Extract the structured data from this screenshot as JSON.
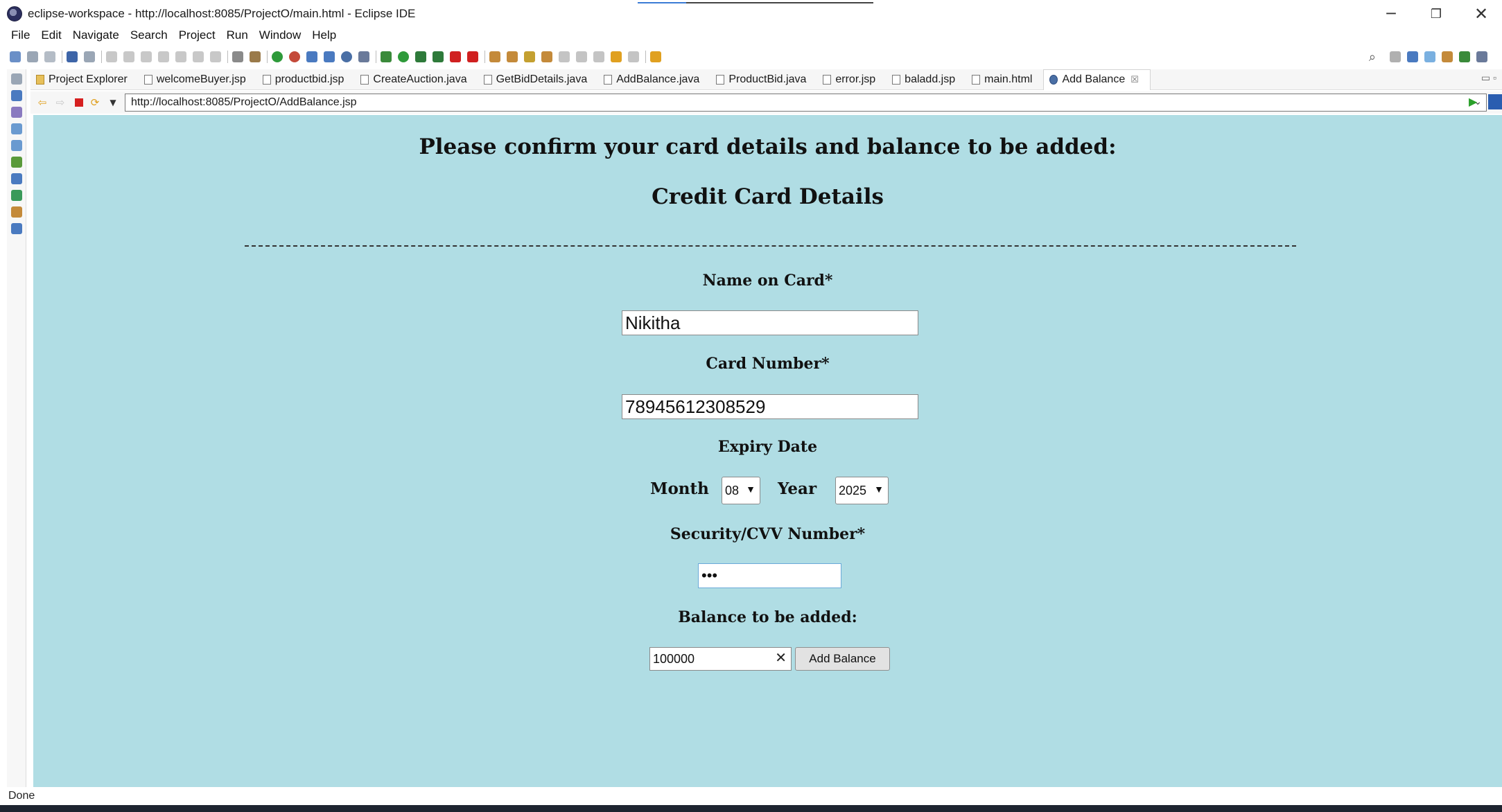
{
  "window": {
    "title": "eclipse-workspace - http://localhost:8085/ProjectO/main.html - Eclipse IDE",
    "controls": {
      "minimize": "─",
      "maximize": "❐",
      "close": "✕"
    }
  },
  "menu": [
    "File",
    "Edit",
    "Navigate",
    "Search",
    "Project",
    "Run",
    "Window",
    "Help"
  ],
  "tabs": [
    {
      "label": "Project Explorer",
      "icon": "project-explorer-icon"
    },
    {
      "label": "welcomeBuyer.jsp",
      "icon": "file-icon"
    },
    {
      "label": "productbid.jsp",
      "icon": "file-icon"
    },
    {
      "label": "CreateAuction.java",
      "icon": "java-file-icon"
    },
    {
      "label": "GetBidDetails.java",
      "icon": "java-file-icon"
    },
    {
      "label": "AddBalance.java",
      "icon": "java-file-icon"
    },
    {
      "label": "ProductBid.java",
      "icon": "java-file-icon"
    },
    {
      "label": "error.jsp",
      "icon": "file-icon"
    },
    {
      "label": "baladd.jsp",
      "icon": "file-icon"
    },
    {
      "label": "main.html",
      "icon": "file-icon"
    },
    {
      "label": "Add Balance",
      "icon": "globe-icon",
      "active": true,
      "close": "☒"
    }
  ],
  "browser": {
    "url": "http://localhost:8085/ProjectO/AddBalance.jsp"
  },
  "page": {
    "heading": "Please confirm your card details and balance to be added:",
    "subheading": "Credit Card Details",
    "name_label": "Name on Card*",
    "name_value": "Nikitha",
    "card_label": "Card Number*",
    "card_value": "78945612308529",
    "expiry_label": "Expiry Date",
    "month_label": "Month",
    "month_value": "08",
    "year_label": "Year",
    "year_value": "2025",
    "cvv_label": "Security/CVV Number*",
    "cvv_value": "•••",
    "balance_label": "Balance to be added:",
    "balance_value": "100000",
    "submit_label": "Add Balance"
  },
  "status": {
    "text": "Done"
  },
  "colors": {
    "page_background": "#b0dde4"
  }
}
